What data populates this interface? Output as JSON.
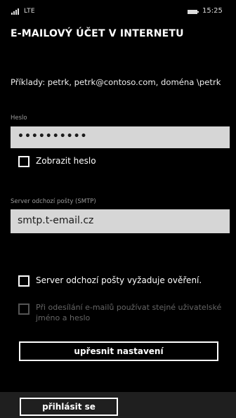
{
  "status_bar": {
    "network": "LTE",
    "time": "15:25"
  },
  "title": "E-MAILOVÝ ÚČET V INTERNETU",
  "examples_text": "Příklady: petrk, petrk@contoso.com, doména \\petrk",
  "password": {
    "label": "Heslo",
    "value": "••••••••••"
  },
  "show_password": {
    "label": "Zobrazit heslo",
    "checked": false
  },
  "smtp": {
    "label": "Server odchozí pošty (SMTP)",
    "value": "smtp.t-email.cz"
  },
  "requires_auth": {
    "label": "Server odchozí pošty vyžaduje ověření.",
    "checked": false
  },
  "same_credentials": {
    "label": "Při odesílání e-mailů používat stejné uživatelské jméno a heslo",
    "checked": false,
    "enabled": false
  },
  "advanced_button": "upřesnit nastavení",
  "app_bar": {
    "login_button": "přihlásit se"
  }
}
